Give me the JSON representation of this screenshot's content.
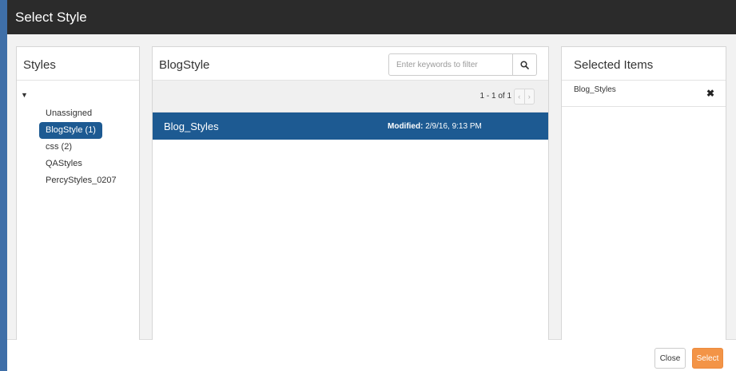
{
  "dialog": {
    "title": "Select Style"
  },
  "styles_panel": {
    "header": "Styles",
    "toggle_glyph": "▼",
    "items": [
      {
        "label": "Unassigned",
        "selected": false
      },
      {
        "label": "BlogStyle (1)",
        "selected": true
      },
      {
        "label": "css (2)",
        "selected": false
      },
      {
        "label": "QAStyles",
        "selected": false
      },
      {
        "label": "PercyStyles_0207",
        "selected": false
      }
    ]
  },
  "results_panel": {
    "header": "BlogStyle",
    "search": {
      "placeholder": "Enter keywords to filter",
      "value": "",
      "icon": "search-icon"
    },
    "pager": {
      "text": "1 - 1 of 1",
      "prev_glyph": "‹",
      "next_glyph": "›"
    },
    "rows": [
      {
        "name": "Blog_Styles",
        "modified_label": "Modified:",
        "modified_value": "2/9/16, 9:13 PM"
      }
    ]
  },
  "selected_panel": {
    "header": "Selected Items",
    "items": [
      {
        "label": "Blog_Styles",
        "remove_glyph": "✖"
      }
    ]
  },
  "footer": {
    "close_label": "Close",
    "select_label": "Select"
  },
  "colors": {
    "titlebar": "#2b2b2b",
    "selection": "#1d5a92",
    "primary_button": "#f39447"
  }
}
